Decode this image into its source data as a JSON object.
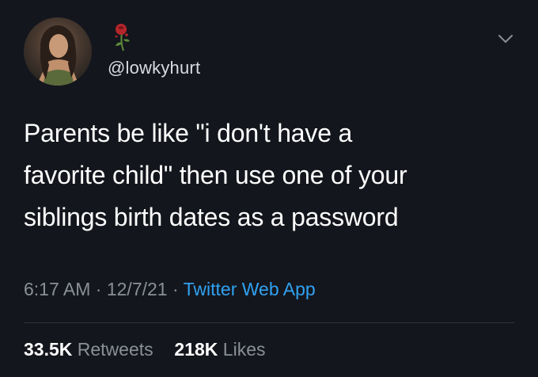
{
  "author": {
    "handle": "@lowkyhurt",
    "display_emoji": "rose-wilted-icon"
  },
  "tweet": {
    "text": "Parents be like \"i don't have a\nfavorite child\" then use one of your\nsiblings birth dates as a password",
    "time": "6:17 AM",
    "date": "12/7/21",
    "separator": "·",
    "source": "Twitter Web App"
  },
  "stats": {
    "retweets_count": "33.5K",
    "retweets_label": "Retweets",
    "likes_count": "218K",
    "likes_label": "Likes"
  },
  "colors": {
    "background": "#14161d",
    "link": "#2fa2f2",
    "muted": "#8a8f98"
  }
}
